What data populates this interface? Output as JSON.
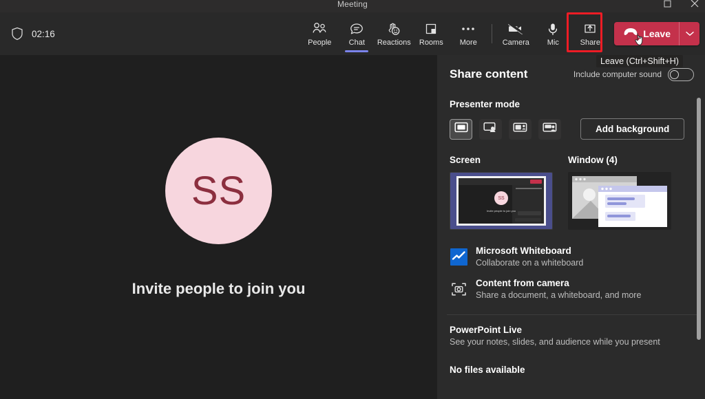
{
  "window": {
    "title": "Meeting",
    "controls": [
      {
        "name": "restore-button",
        "glyph": "restore"
      },
      {
        "name": "close-button",
        "glyph": "close"
      }
    ]
  },
  "toolbar": {
    "shield_icon": "shield-icon",
    "timer": "02:16",
    "items": [
      {
        "label": "People",
        "icon": "people-icon",
        "active": false
      },
      {
        "label": "Chat",
        "icon": "chat-icon",
        "active": true
      },
      {
        "label": "Reactions",
        "icon": "reactions-icon",
        "active": false
      },
      {
        "label": "Rooms",
        "icon": "rooms-icon",
        "active": false
      },
      {
        "label": "More",
        "icon": "more-icon",
        "active": false
      }
    ],
    "media": [
      {
        "label": "Camera",
        "icon": "camera-off-icon",
        "muted": true
      },
      {
        "label": "Mic",
        "icon": "mic-icon",
        "muted": false
      },
      {
        "label": "Share",
        "icon": "share-up-arrow-icon",
        "highlighted": true
      }
    ],
    "leave": {
      "label": "Leave",
      "icon": "hangup-phone-icon",
      "caret_icon": "chevron-down-icon",
      "color": "#c4314b"
    },
    "tooltip": "Leave (Ctrl+Shift+H)",
    "highlight_color": "#ee1c25",
    "active_tab_color": "#7b83eb"
  },
  "stage": {
    "avatar_initials": "SS",
    "avatar_bg": "#f7d6de",
    "avatar_fg": "#8c2f3f",
    "invite_text": "Invite people to join you"
  },
  "share_panel": {
    "title": "Share content",
    "include_sound_label": "Include computer sound",
    "include_sound_on": false,
    "presenter_mode": {
      "label": "Presenter mode",
      "options": [
        {
          "name": "content-only-mode",
          "selected": true
        },
        {
          "name": "standout-mode",
          "selected": false
        },
        {
          "name": "side-by-side-mode",
          "selected": false
        },
        {
          "name": "reporter-mode",
          "selected": false
        }
      ],
      "add_background_label": "Add background"
    },
    "sources": [
      {
        "title": "Screen",
        "thumb": "screen-thumbnail"
      },
      {
        "title": "Window (4)",
        "thumb": "window-thumbnail"
      }
    ],
    "options": [
      {
        "icon": "whiteboard-icon",
        "title": "Microsoft Whiteboard",
        "subtitle": "Collaborate on a whiteboard"
      },
      {
        "icon": "content-camera-icon",
        "title": "Content from camera",
        "subtitle": "Share a document, a whiteboard, and more"
      }
    ],
    "powerpoint": {
      "title": "PowerPoint Live",
      "subtitle": "See your notes, slides, and audience while you present"
    },
    "no_files": "No files available"
  }
}
